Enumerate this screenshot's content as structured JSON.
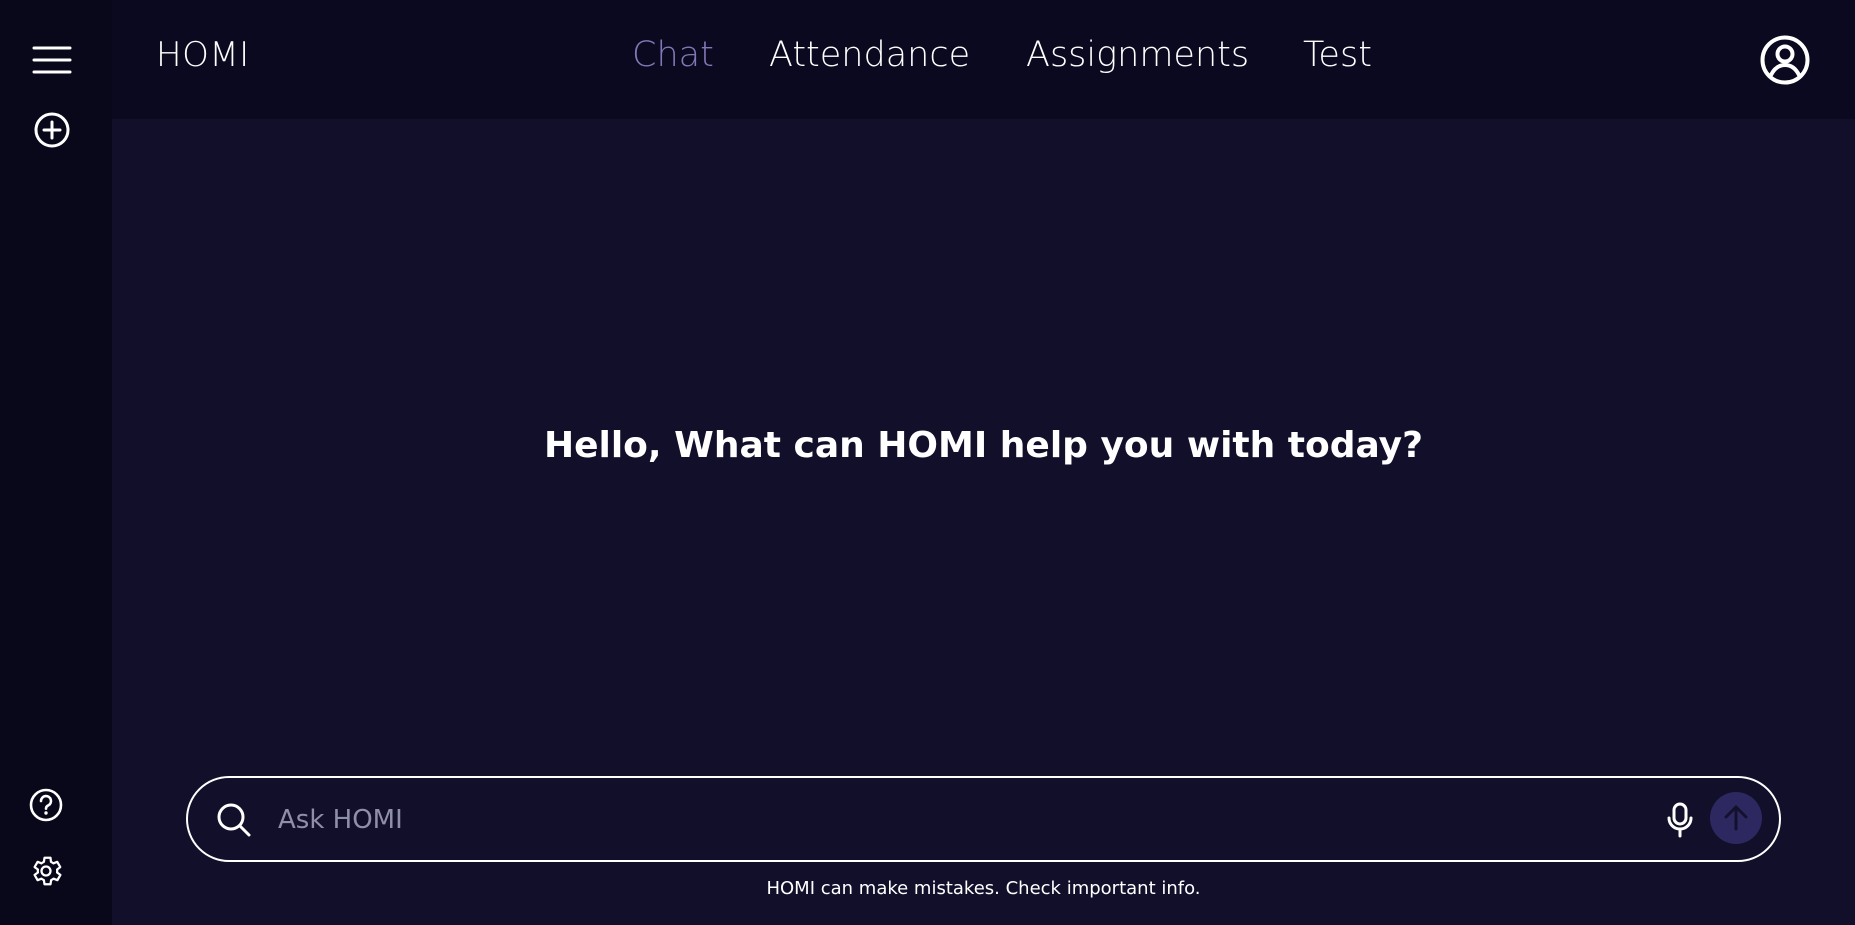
{
  "app": {
    "brand": "HOMI"
  },
  "nav": {
    "items": [
      {
        "label": "Chat",
        "active": true
      },
      {
        "label": "Attendance",
        "active": false
      },
      {
        "label": "Assignments",
        "active": false
      },
      {
        "label": "Test",
        "active": false
      }
    ]
  },
  "sidebar": {
    "icons": [
      "menu-icon",
      "new-chat-icon",
      "help-icon",
      "settings-icon"
    ]
  },
  "header": {
    "account_icon": "account-icon"
  },
  "main": {
    "greeting": "Hello, What can HOMI help you with today?"
  },
  "search": {
    "placeholder": "Ask HOMI",
    "value": ""
  },
  "footer": {
    "disclaimer": "HOMI can make mistakes. Check important info."
  },
  "colors": {
    "background": "#120f2b",
    "sidebar": "#09071a",
    "topbar": "#0b0920",
    "active_nav": "#8278b6",
    "send_button": "#2d2860"
  }
}
